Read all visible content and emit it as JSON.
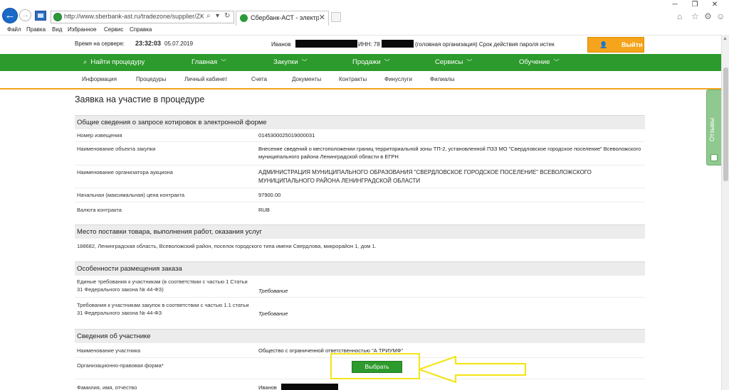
{
  "browser": {
    "address": "http://www.sberbank-ast.ru/tradezone/supplier/ZK/Purc",
    "tab_title": "Сбербанк-АСТ - электрон...",
    "menu": [
      "Файл",
      "Правка",
      "Вид",
      "Избранное",
      "Сервис",
      "Справка"
    ]
  },
  "header": {
    "server_label": "Время на сервере:",
    "server_time": "23:32:03",
    "server_date": "05.07.2019",
    "user_name": "Иванов",
    "inn_label": "ИНН: 78",
    "org_info": "(головная организация) Срок действия пароля истек",
    "exit_label": "Выйти"
  },
  "nav": {
    "find_procedure": "Найти процедуру",
    "items": [
      "Главная",
      "Закупки",
      "Продажи",
      "Сервисы",
      "Обучение"
    ]
  },
  "subnav": [
    "Информация",
    "Процедуры",
    "Личный кабинет",
    "Счета",
    "Документы",
    "Контракты",
    "Финуслуги",
    "Филиалы"
  ],
  "feedback_label": "Отзывы",
  "page_title": "Заявка на участие в процедуре",
  "sections": {
    "general": {
      "title": "Общие сведения о запросе котировок в электронной форме",
      "rows": [
        {
          "label": "Номер извещения",
          "value": "0145300025019000031"
        },
        {
          "label": "Наименование объекта закупки",
          "value": "Внесение сведений о местоположении границ территориальной зоны ТП-2, установленной ПЗЗ МО \"Свердловское городское поселение\" Всеволожского муниципального района Ленинградской области в ЕГРН"
        },
        {
          "label": "Наименование организатора аукциона",
          "value": "АДМИНИСТРАЦИЯ МУНИЦИПАЛЬНОГО ОБРАЗОВАНИЯ \"СВЕРДЛОВСКОЕ ГОРОДСКОЕ ПОСЕЛЕНИЕ\" ВСЕВОЛОЖСКОГО МУНИЦИПАЛЬНОГО РАЙОНА ЛЕНИНГРАДСКОЙ ОБЛАСТИ"
        },
        {
          "label": "Начальная (максимальная) цена контракта",
          "value": "97900.00"
        },
        {
          "label": "Валюта контракта",
          "value": "RUB"
        }
      ]
    },
    "delivery": {
      "title": "Место поставки товара, выполнения работ, оказания услуг",
      "address": "188682, Ленинградская область, Всеволожский район, поселок городского типа имени Свердлова, микрорайон 1, дом 1."
    },
    "features": {
      "title": "Особенности размещения заказа",
      "rows": [
        {
          "label": "Единые требования к участникам (в соответствии с частью 1 Статьи 31 Федерального закона № 44-ФЗ)",
          "value": "Требование"
        },
        {
          "label": "Требования к участникам закупок в соответствии с частью 1.1 статьи 31 Федерального закона № 44-ФЗ",
          "value": "Требование"
        }
      ]
    },
    "participant": {
      "title": "Сведения об участнике",
      "rows": [
        {
          "label": "Наименование участника",
          "value": "Общество с ограниченной ответственностью \"А ТРИУМФ\""
        },
        {
          "label": "Организационно-правовая форма*",
          "value": ""
        },
        {
          "label": "Фамилия, имя, отчество",
          "value": "Иванов"
        }
      ],
      "select_label": "Выбрать"
    }
  }
}
